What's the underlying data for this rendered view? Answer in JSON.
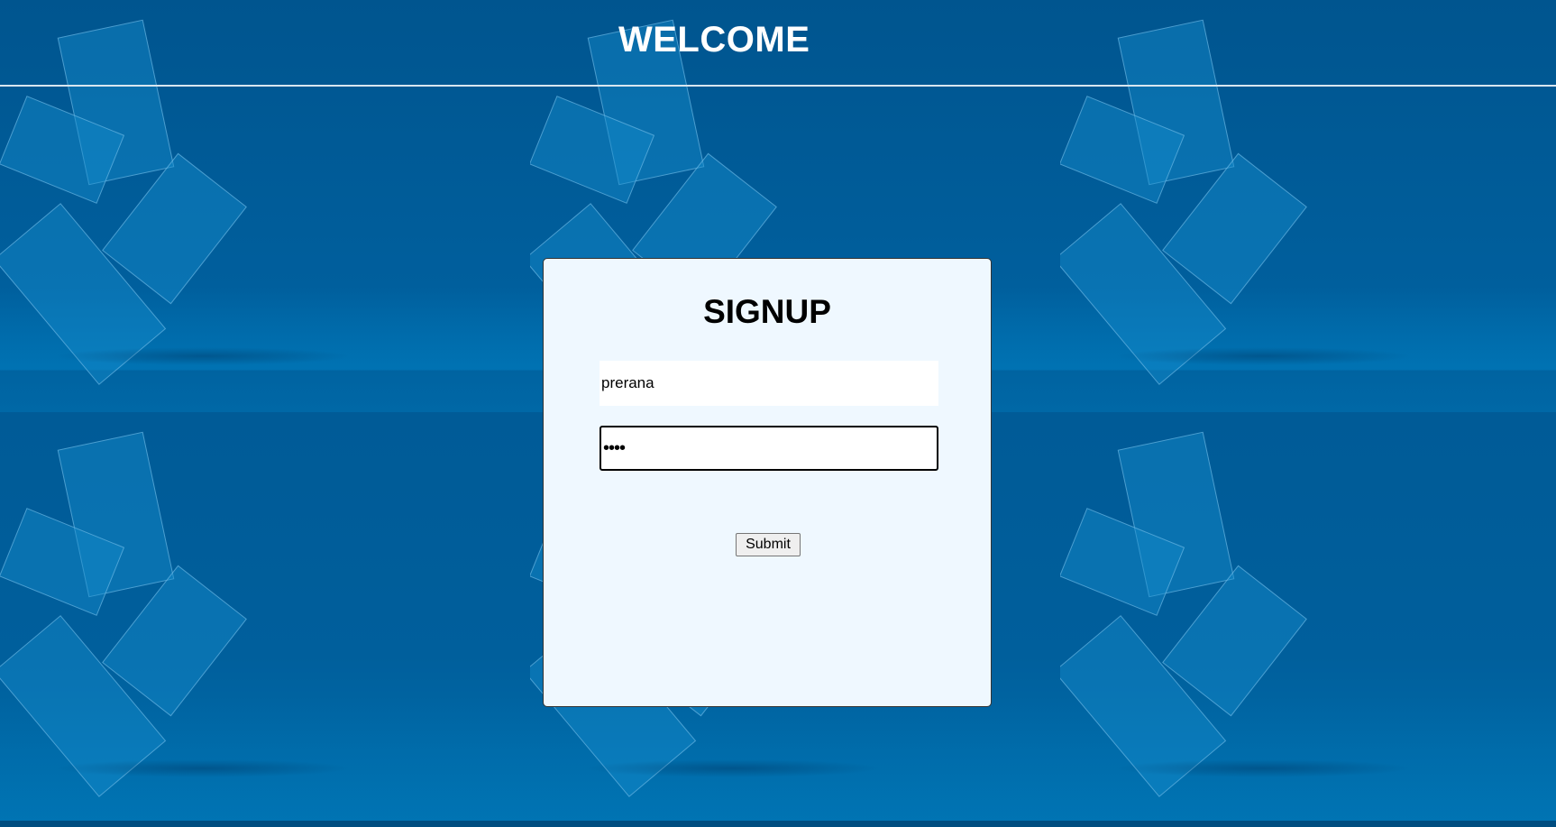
{
  "header": {
    "title": "WELCOME"
  },
  "signup": {
    "title": "SIGNUP",
    "username_value": "prerana",
    "password_value": "••••",
    "submit_label": "Submit"
  },
  "colors": {
    "background": "#005a93",
    "card_background": "#eff8ff",
    "header_text": "#ffffff"
  }
}
